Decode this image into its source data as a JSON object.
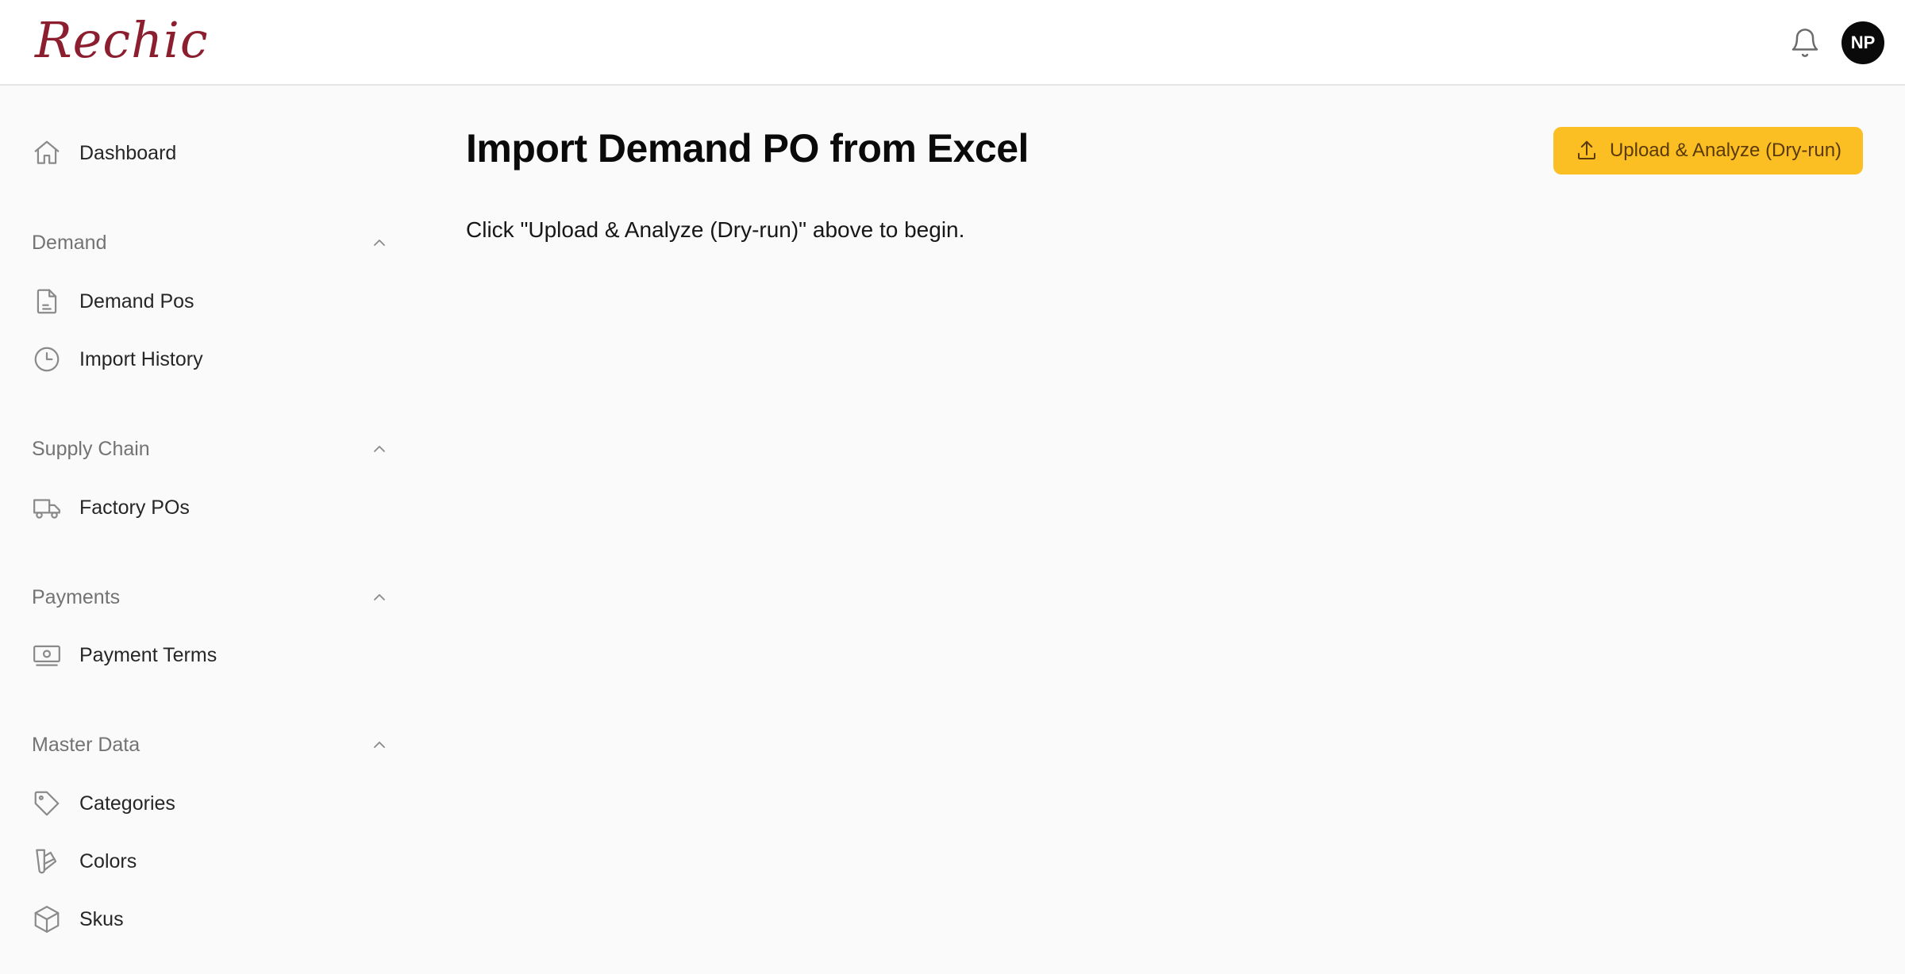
{
  "app": {
    "logo_text": "Rechic",
    "logo_color": "#8b1e2f",
    "user_initials": "NP"
  },
  "sidebar": {
    "dashboard": {
      "label": "Dashboard",
      "icon": "home-icon"
    },
    "sections": [
      {
        "label": "Demand",
        "expanded": true,
        "items": [
          {
            "label": "Demand Pos",
            "icon": "document-icon"
          },
          {
            "label": "Import History",
            "icon": "clock-icon"
          }
        ]
      },
      {
        "label": "Supply Chain",
        "expanded": true,
        "items": [
          {
            "label": "Factory POs",
            "icon": "truck-icon"
          }
        ]
      },
      {
        "label": "Payments",
        "expanded": true,
        "items": [
          {
            "label": "Payment Terms",
            "icon": "banknote-icon"
          }
        ]
      },
      {
        "label": "Master Data",
        "expanded": true,
        "items": [
          {
            "label": "Categories",
            "icon": "tag-icon"
          },
          {
            "label": "Colors",
            "icon": "swatch-icon"
          },
          {
            "label": "Skus",
            "icon": "cube-icon"
          }
        ]
      }
    ]
  },
  "main": {
    "title": "Import Demand PO from Excel",
    "hint": "Click \"Upload & Analyze (Dry-run)\" above to begin.",
    "upload_button": {
      "label": "Upload & Analyze (Dry-run)",
      "icon": "upload-icon",
      "color": "#fbbf24"
    }
  }
}
